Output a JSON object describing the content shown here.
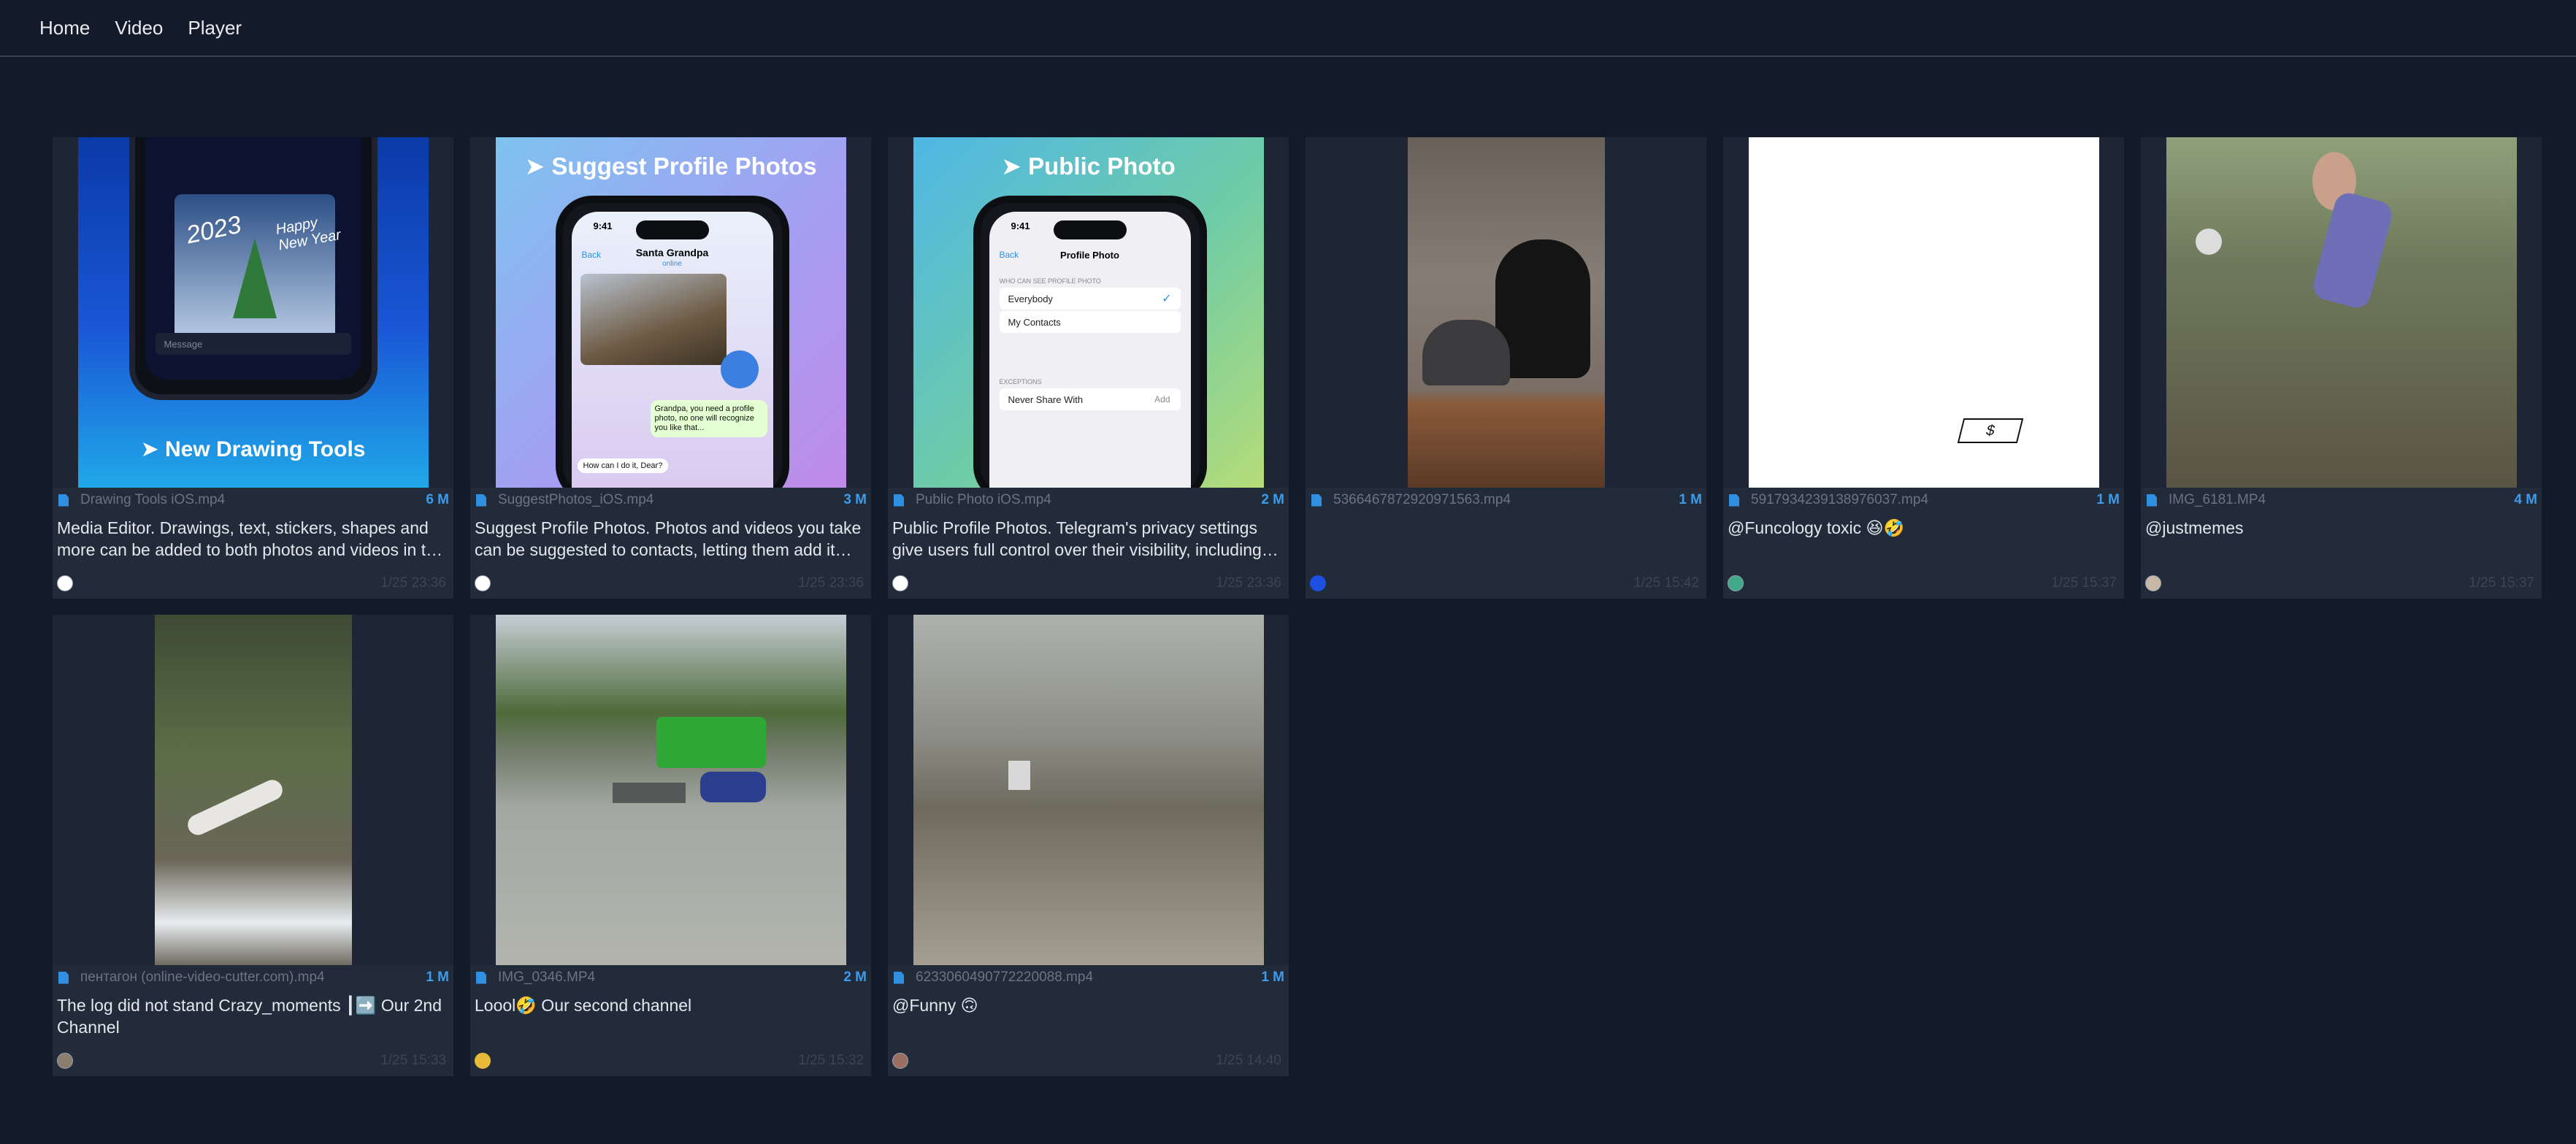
{
  "nav": {
    "items": [
      "Home",
      "Video",
      "Player"
    ]
  },
  "cards": [
    {
      "file": "Drawing Tools iOS.mp4",
      "size": "6 M",
      "caption": "Media Editor. Drawings, text, stickers, shapes and more can be added to both photos and videos in the medi...",
      "date": "1/25 23:36",
      "banner": "New Drawing Tools",
      "year": "2023",
      "greeting": "Happy New Year",
      "input": "Message"
    },
    {
      "file": "SuggestPhotos_iOS.mp4",
      "size": "3 M",
      "caption": "Suggest Profile Photos. Photos and videos you take can be suggested to contacts, letting them add it to...",
      "date": "1/25 23:36",
      "banner": "Suggest Profile Photos",
      "time": "9:41",
      "back": "Back",
      "contact": "Santa Grandpa",
      "status": "online",
      "msg1": "Grandpa, you need a profile photo, no one will recognize you like that...",
      "msg2": "How can I do it, Dear?"
    },
    {
      "file": "Public Photo iOS.mp4",
      "size": "2 M",
      "caption": "Public Profile Photos. Telegram's privacy settings give users full control over their visibility, including who is...",
      "date": "1/25 23:36",
      "banner": "Public Photo",
      "time": "9:41",
      "back": "Back",
      "screen_title": "Profile Photo",
      "section": "WHO CAN SEE PROFILE PHOTO",
      "opt1": "Everybody",
      "opt2": "My Contacts",
      "exceptions": "EXCEPTIONS",
      "never": "Never Share With",
      "add": "Add"
    },
    {
      "file": "5366467872920971563.mp4",
      "size": "1 M",
      "caption": "",
      "date": "1/25 15:42"
    },
    {
      "file": "5917934239138976037.mp4",
      "size": "1 M",
      "caption": "@Funcology toxic 😆🤣",
      "date": "1/25 15:37"
    },
    {
      "file": "IMG_6181.MP4",
      "size": "4 M",
      "caption": "@justmemes",
      "date": "1/25 15:37"
    },
    {
      "file": "пентагон (online-video-cutter.com).mp4",
      "size": "1 M",
      "caption": "The log did not stand Crazy_moments ┃➡️ Our 2nd Channel",
      "date": "1/25 15:33"
    },
    {
      "file": "IMG_0346.MP4",
      "size": "2 M",
      "caption": "Loool🤣 Our second channel",
      "date": "1/25 15:32"
    },
    {
      "file": "6233060490772220088.mp4",
      "size": "1 M",
      "caption": "@Funny 🙃",
      "date": "1/25 14:40"
    }
  ],
  "colors": {
    "background": "#131a29",
    "card": "#222b3a",
    "accent": "#3d9be9"
  }
}
